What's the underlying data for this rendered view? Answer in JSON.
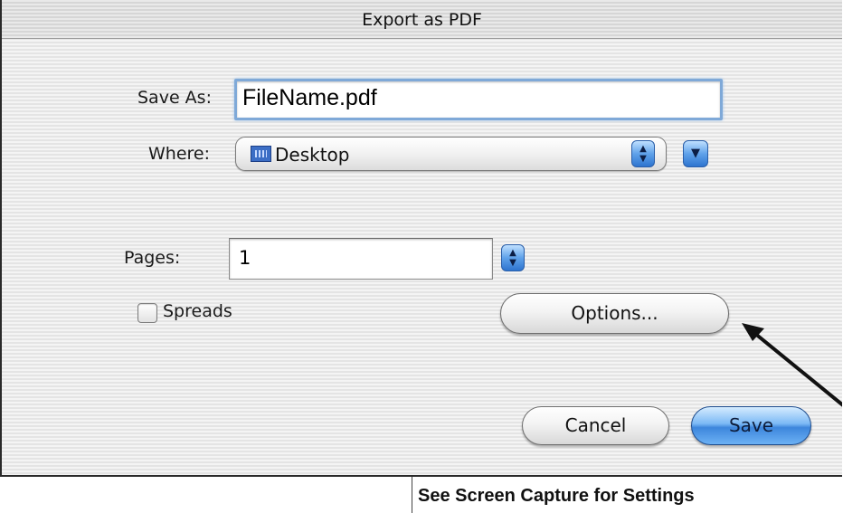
{
  "dialog": {
    "title": "Export as PDF",
    "save_as": {
      "label": "Save As:",
      "value": "FileName.pdf"
    },
    "where": {
      "label": "Where:",
      "selected": "Desktop",
      "icon": "desktop-folder-icon"
    },
    "pages": {
      "label": "Pages:",
      "value": "1"
    },
    "spreads": {
      "label": "Spreads",
      "checked": false
    },
    "buttons": {
      "options": "Options...",
      "cancel": "Cancel",
      "save": "Save"
    },
    "colors": {
      "accent": "#5fa2ea",
      "focus_ring": "#7fa9d8"
    }
  },
  "caption": "See Screen Capture for Settings"
}
